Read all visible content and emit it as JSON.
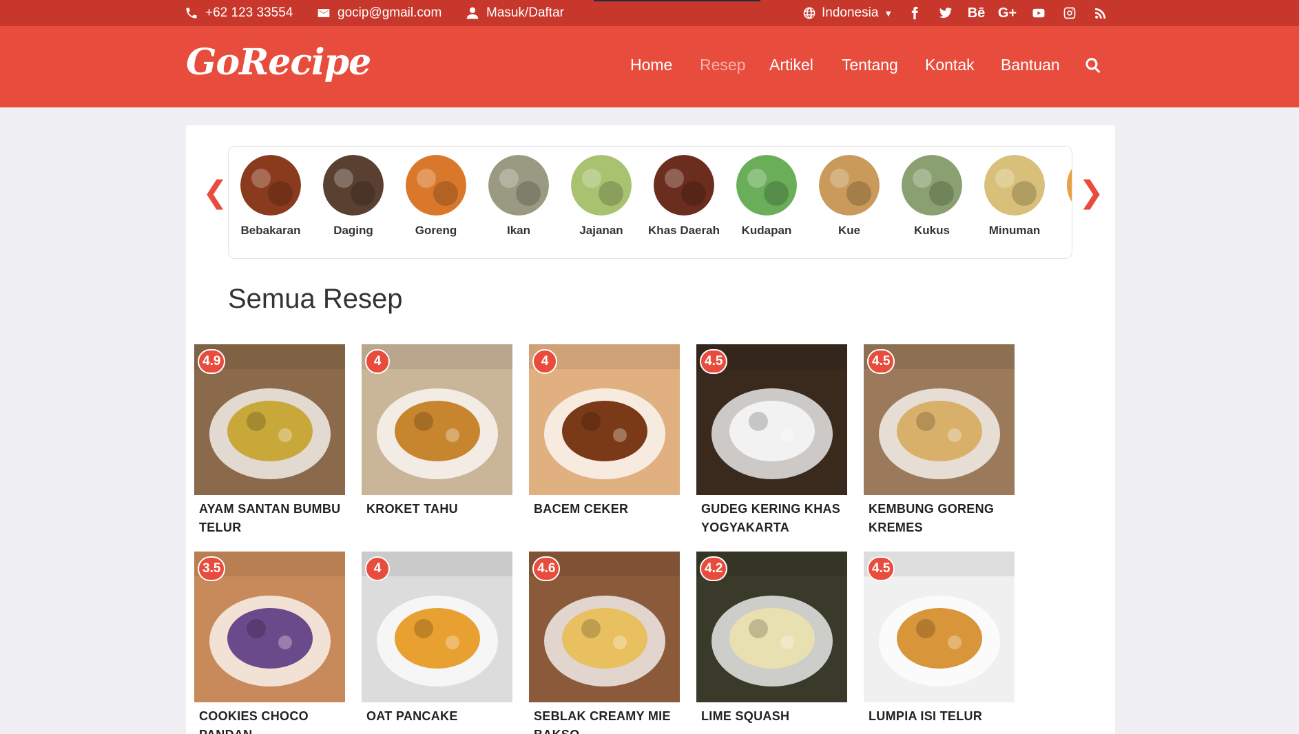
{
  "topbar": {
    "phone": "+62 123 33554",
    "email": "gocip@gmail.com",
    "login": "Masuk/Daftar",
    "language": "Indonesia",
    "social": [
      {
        "icon": "facebook-icon"
      },
      {
        "icon": "twitter-icon"
      },
      {
        "icon": "behance-icon",
        "text": "Bē"
      },
      {
        "icon": "google-plus-icon",
        "text": "G+"
      },
      {
        "icon": "youtube-icon"
      },
      {
        "icon": "instagram-icon"
      },
      {
        "icon": "rss-icon"
      }
    ]
  },
  "header": {
    "logo": "GoRecipe",
    "nav": [
      "Home",
      "Resep",
      "Artikel",
      "Tentang",
      "Kontak",
      "Bantuan"
    ],
    "active_nav": "Resep"
  },
  "categories": [
    {
      "label": "Bebakaran",
      "color": "#8a3b1e"
    },
    {
      "label": "Daging",
      "color": "#5a4030"
    },
    {
      "label": "Goreng",
      "color": "#d9782a"
    },
    {
      "label": "Ikan",
      "color": "#9a9a82"
    },
    {
      "label": "Jajanan",
      "color": "#a8c270"
    },
    {
      "label": "Khas Daerah",
      "color": "#6b2e1e"
    },
    {
      "label": "Kudapan",
      "color": "#6aae5a"
    },
    {
      "label": "Kue",
      "color": "#c99a5a"
    },
    {
      "label": "Kukus",
      "color": "#8aa070"
    },
    {
      "label": "Minuman",
      "color": "#d8c07a"
    }
  ],
  "carousel": {
    "prev": "❮",
    "next": "❯"
  },
  "section_title": "Semua Resep",
  "recipes": [
    {
      "title": "AYAM SANTAN BUMBU TELUR",
      "rating": "4.9",
      "bg": "#8a6a4a",
      "accent": "#c9a83a"
    },
    {
      "title": "KROKET TAHU",
      "rating": "4",
      "bg": "#c9b598",
      "accent": "#c7862e"
    },
    {
      "title": "BACEM CEKER",
      "rating": "4",
      "bg": "#e0b080",
      "accent": "#7a3a18"
    },
    {
      "title": "GUDEG KERING KHAS YOGYAKARTA",
      "rating": "4.5",
      "bg": "#3a2a1e",
      "accent": "#f2f2f2"
    },
    {
      "title": "KEMBUNG GORENG KREMES",
      "rating": "4.5",
      "bg": "#9a7a5a",
      "accent": "#d9b06a"
    },
    {
      "title": "COOKIES CHOCO PANDAN",
      "rating": "3.5",
      "bg": "#c88a5a",
      "accent": "#6a4a8a"
    },
    {
      "title": "OAT PANCAKE",
      "rating": "4",
      "bg": "#dcdcdc",
      "accent": "#e8a030"
    },
    {
      "title": "SEBLAK CREAMY MIE BAKSO",
      "rating": "4.6",
      "bg": "#8a5a3a",
      "accent": "#e8c060"
    },
    {
      "title": "LIME SQUASH",
      "rating": "4.2",
      "bg": "#3a3a2a",
      "accent": "#e8e0b0"
    },
    {
      "title": "LUMPIA ISI TELUR",
      "rating": "4.5",
      "bg": "#f0f0f0",
      "accent": "#d8953a"
    }
  ],
  "colors": {
    "brand": "#e84c3d",
    "topbar": "#c8372c"
  }
}
